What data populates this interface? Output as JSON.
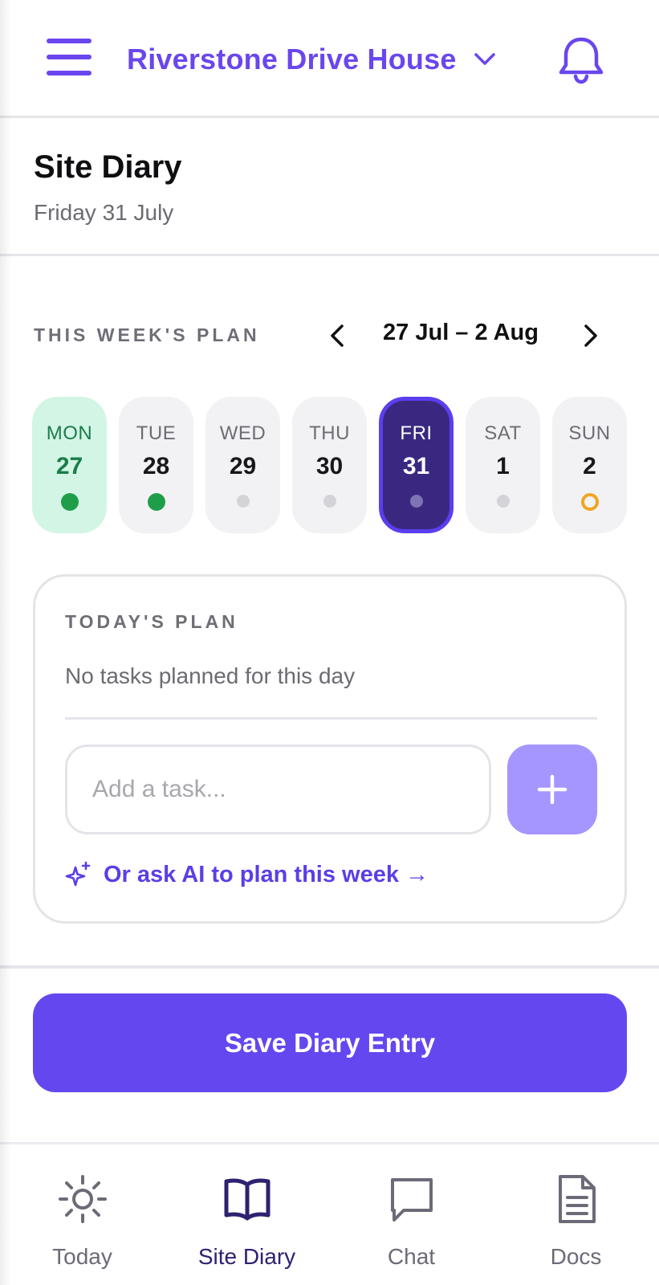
{
  "header": {
    "project_name": "Riverstone Drive House",
    "menu_icon": "hamburger-menu-icon",
    "bell_icon": "bell-icon",
    "accent_color": "#6a46ee"
  },
  "page": {
    "title": "Site Diary",
    "date": "Friday 31 July"
  },
  "week_plan": {
    "label": "THIS WEEK'S PLAN",
    "range": "27 Jul – 2 Aug",
    "days": [
      {
        "name": "MON",
        "num": "27",
        "status": "complete"
      },
      {
        "name": "TUE",
        "num": "28",
        "status": "complete"
      },
      {
        "name": "WED",
        "num": "29",
        "status": "none"
      },
      {
        "name": "THU",
        "num": "30",
        "status": "none"
      },
      {
        "name": "FRI",
        "num": "31",
        "status": "selected"
      },
      {
        "name": "SAT",
        "num": "1",
        "status": "none"
      },
      {
        "name": "SUN",
        "num": "2",
        "status": "pending"
      }
    ]
  },
  "todays_plan": {
    "label": "TODAY'S PLAN",
    "empty_text": "No tasks planned for this day",
    "input_placeholder": "Add a task...",
    "ai_link": "Or ask AI to plan this week →"
  },
  "save_button": "Save Diary Entry",
  "bottom_nav": [
    {
      "label": "Today",
      "icon": "sun-icon",
      "active": false
    },
    {
      "label": "Site Diary",
      "icon": "book-icon",
      "active": true
    },
    {
      "label": "Chat",
      "icon": "chat-bubble-icon",
      "active": false
    },
    {
      "label": "Docs",
      "icon": "document-icon",
      "active": false
    }
  ],
  "colors": {
    "primary": "#6547ef",
    "complete_dot": "#1e9e49",
    "pending_ring": "#f0a524",
    "selected_day": "#3a2880"
  }
}
